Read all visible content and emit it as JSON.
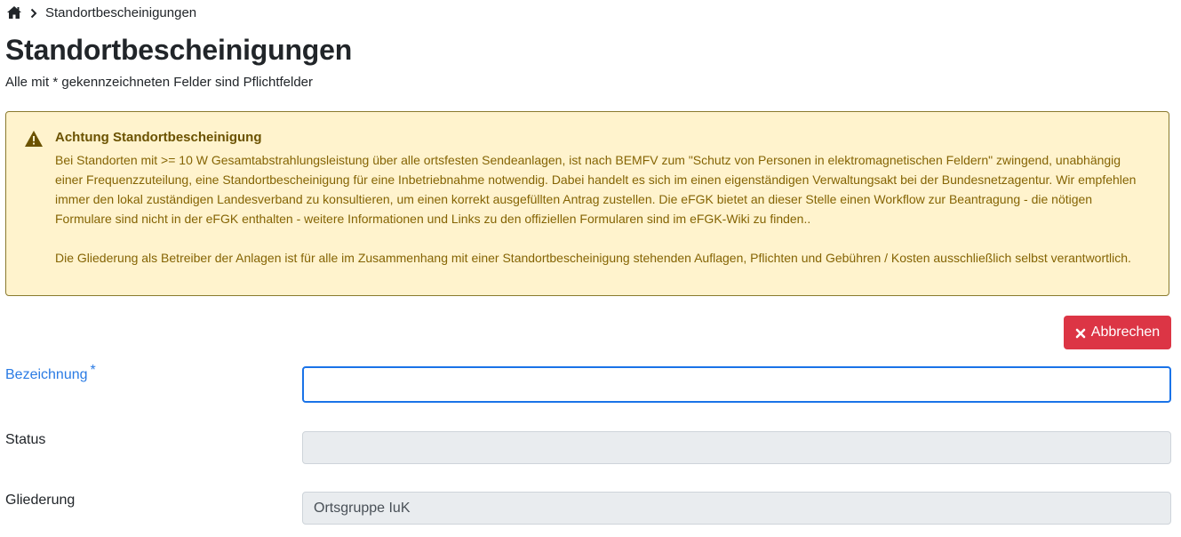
{
  "breadcrumb": {
    "home_icon": "home-icon",
    "separator_icon": "chevron-right-icon",
    "current": "Standortbescheinigungen"
  },
  "page": {
    "title": "Standortbescheinigungen",
    "subtitle": "Alle mit * gekennzeichneten Felder sind Pflichtfelder"
  },
  "alert": {
    "icon": "warning-triangle-icon",
    "title": "Achtung Standortbescheinigung",
    "paragraph1": "Bei Standorten mit >= 10 W Gesamtabstrahlungsleistung über alle ortsfesten Sendeanlagen, ist nach BEMFV zum \"Schutz von Personen in elektromagnetischen Feldern\" zwingend, unabhängig einer Frequenzzuteilung, eine Standortbescheinigung für eine Inbetriebnahme notwendig. Dabei handelt es sich im einen eigenständigen Verwaltungsakt bei der Bundesnetzagentur. Wir empfehlen immer den lokal zuständigen Landesverband zu konsultieren, um einen korrekt ausgefüllten Antrag zustellen. Die eFGK bietet an dieser Stelle einen Workflow zur Beantragung - die nötigen Formulare sind nicht in der eFGK enthalten - weitere Informationen und Links zu den offiziellen Formularen sind im eFGK-Wiki zu finden..",
    "paragraph2": "Die Gliederung als Betreiber der Anlagen ist für alle im Zusammenhang mit einer Standortbescheinigung stehenden Auflagen, Pflichten und Gebühren / Kosten ausschließlich selbst verantwortlich.",
    "colors": {
      "background": "#fff3cd",
      "text": "#856404",
      "border": "#8a7a2e"
    }
  },
  "actions": {
    "cancel_label": "Abbrechen",
    "cancel_icon": "close-icon",
    "cancel_color": "#dc3545"
  },
  "form": {
    "bezeichnung": {
      "label": "Bezeichnung",
      "required_mark": "*",
      "value": ""
    },
    "status": {
      "label": "Status",
      "value": ""
    },
    "gliederung": {
      "label": "Gliederung",
      "value": "Ortsgruppe IuK"
    }
  }
}
